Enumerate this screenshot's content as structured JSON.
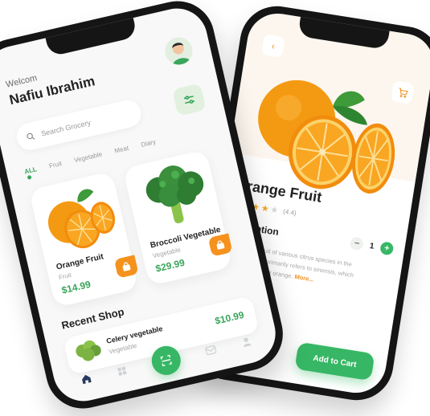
{
  "home": {
    "greeting": "Welcom",
    "user_name": "Nafiu Ibrahim",
    "search_placeholder": "Search Grocery",
    "categories": [
      "ALL",
      "Fruit",
      "Vegetable",
      "Meat",
      "Diary"
    ],
    "products": [
      {
        "name": "Orange Fruit",
        "category": "Fruit",
        "price": "$14.99"
      },
      {
        "name": "Broccoli Vegetable",
        "category": "Vegetable",
        "price": "$29.99"
      }
    ],
    "recent_shop_title": "Recent Shop",
    "recent_shop": [
      {
        "name": "Celery vegetable",
        "category": "Vegetable",
        "price": "$10.99"
      }
    ]
  },
  "detail": {
    "title": "Orange Fruit",
    "rating_stars": 4,
    "rating_text": "(4.4)",
    "description_heading": "Description",
    "quantity": "1",
    "description_text": "Orange is the fruit of various citrus species in the family Rutaceae primarily refers to sinensis, which is also called sweet orange.",
    "more_label": "More...",
    "add_to_cart_label": "Add to Cart"
  },
  "colors": {
    "accent_green": "#37b765",
    "accent_orange": "#f5921e"
  }
}
